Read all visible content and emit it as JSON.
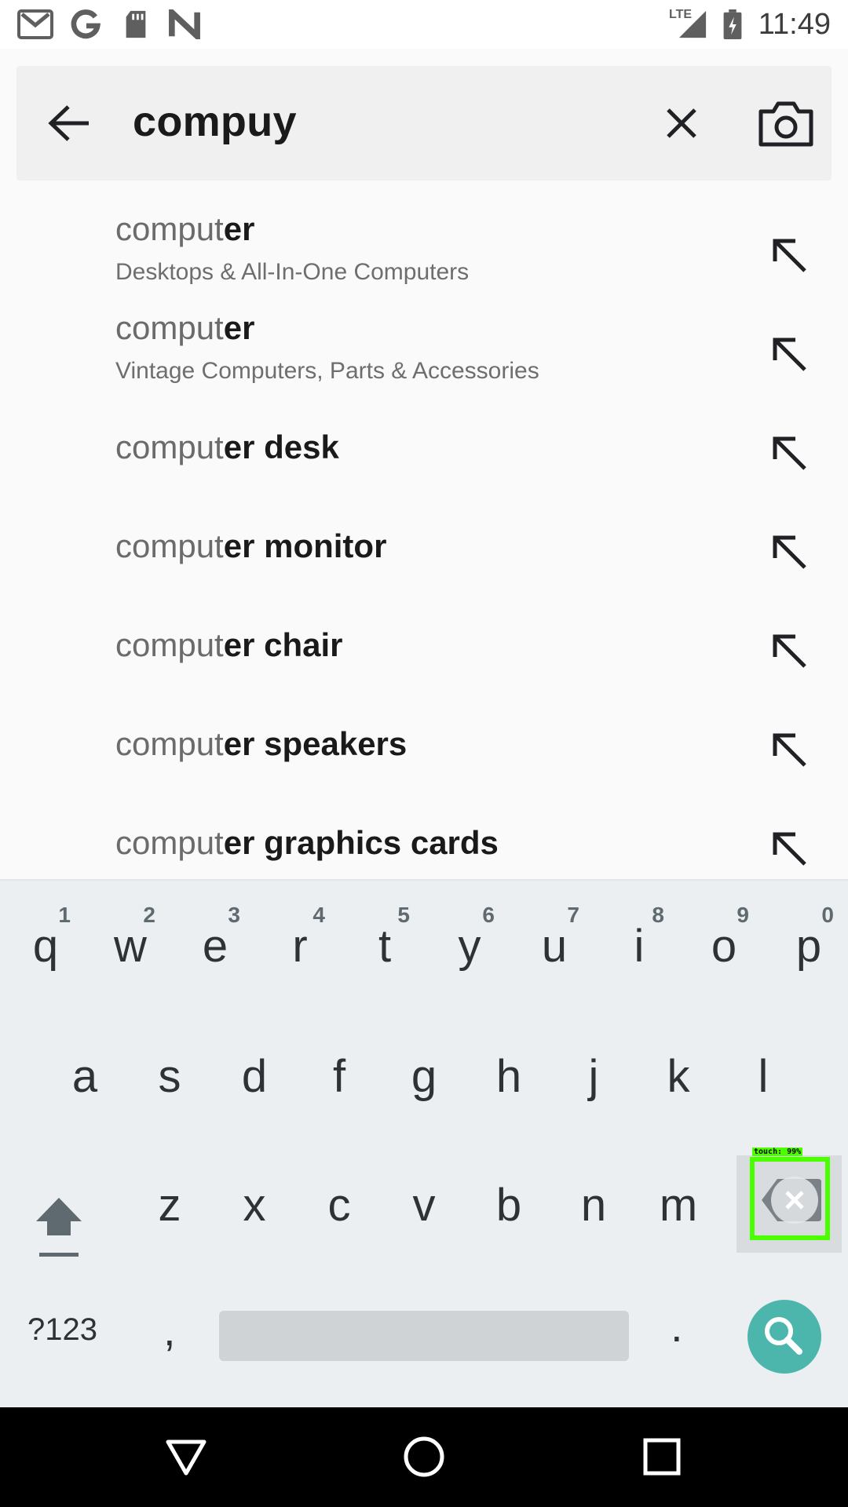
{
  "status_bar": {
    "time": "11:49",
    "network": "LTE",
    "icons": [
      "gmail-icon",
      "google-icon",
      "sd-card-icon",
      "n-icon",
      "signal-icon",
      "battery-charging-icon"
    ]
  },
  "search": {
    "query": "compuy",
    "back_icon": "arrow-back-icon",
    "clear_icon": "close-icon",
    "camera_icon": "camera-icon"
  },
  "suggestions": [
    {
      "prefix": "comput",
      "rest": "er",
      "sub": "Desktops & All-In-One Computers"
    },
    {
      "prefix": "comput",
      "rest": "er",
      "sub": "Vintage Computers, Parts & Accessories"
    },
    {
      "prefix": "comput",
      "rest": "er desk",
      "sub": ""
    },
    {
      "prefix": "comput",
      "rest": "er monitor",
      "sub": ""
    },
    {
      "prefix": "comput",
      "rest": "er chair",
      "sub": ""
    },
    {
      "prefix": "comput",
      "rest": "er speakers",
      "sub": ""
    },
    {
      "prefix": "comput",
      "rest": "er graphics cards",
      "sub": ""
    }
  ],
  "keyboard": {
    "row1": [
      "q",
      "w",
      "e",
      "r",
      "t",
      "y",
      "u",
      "i",
      "o",
      "p"
    ],
    "row1_hints": [
      "1",
      "2",
      "3",
      "4",
      "5",
      "6",
      "7",
      "8",
      "9",
      "0"
    ],
    "row2": [
      "a",
      "s",
      "d",
      "f",
      "g",
      "h",
      "j",
      "k",
      "l"
    ],
    "row3": [
      "z",
      "x",
      "c",
      "v",
      "b",
      "n",
      "m"
    ],
    "symbols_label": "?123",
    "comma": ",",
    "period": ".",
    "touch_label": "touch: 99%"
  },
  "colors": {
    "search_key": "#4db6ac",
    "highlight": "#4cff00"
  }
}
